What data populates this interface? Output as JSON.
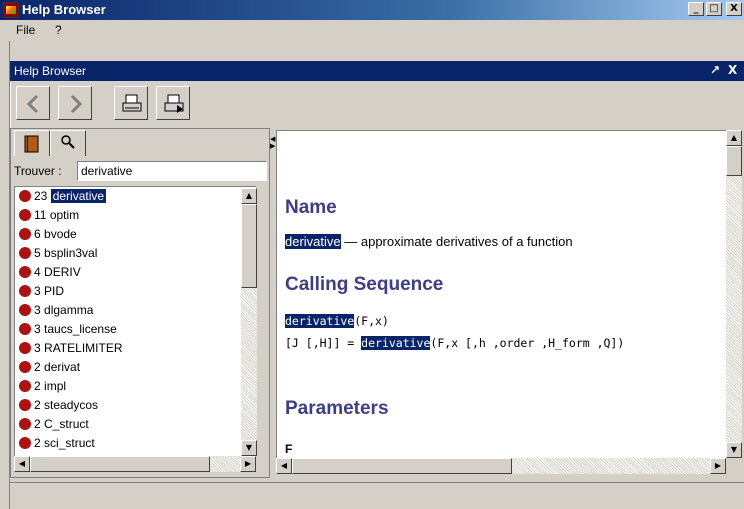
{
  "window": {
    "title": "Help Browser",
    "controls": [
      "_",
      "□",
      "X"
    ]
  },
  "menu": {
    "items": [
      "File",
      "?"
    ]
  },
  "frame": {
    "title": "Help Browser",
    "controls": [
      "↗",
      "X"
    ]
  },
  "toolbar": {
    "buttons": [
      "back-icon",
      "forward-icon",
      "print-icon",
      "print-setup-icon"
    ]
  },
  "search": {
    "label": "Trouver :",
    "value": "derivative"
  },
  "results": [
    {
      "count": "23",
      "term": "derivative",
      "selected": true
    },
    {
      "count": "11",
      "term": "optim"
    },
    {
      "count": "6",
      "term": "bvode"
    },
    {
      "count": "5",
      "term": "bsplin3val"
    },
    {
      "count": "4",
      "term": "DERIV"
    },
    {
      "count": "3",
      "term": "PID"
    },
    {
      "count": "3",
      "term": "dlgamma"
    },
    {
      "count": "3",
      "term": "taucs_license"
    },
    {
      "count": "3",
      "term": "RATELIMITER"
    },
    {
      "count": "2",
      "term": "derivat"
    },
    {
      "count": "2",
      "term": "impl"
    },
    {
      "count": "2",
      "term": "steadycos"
    },
    {
      "count": "2",
      "term": "C_struct"
    },
    {
      "count": "2",
      "term": "sci_struct"
    }
  ],
  "doc": {
    "name_heading": "Name",
    "name_term": "derivative",
    "name_desc": " — approximate derivatives of a function",
    "calling_heading": "Calling Sequence",
    "call1_fn": "derivative",
    "call1_args": "(F,x)",
    "call2_prefix": "[J [,H]] = ",
    "call2_fn": "derivative",
    "call2_args": "(F,x [,h ,order ,H_form ,Q])",
    "params_heading": "Parameters",
    "param_first": "F"
  },
  "colors": {
    "titlebar": "#0a246a",
    "heading": "#3d3d8b",
    "dot": "#b01010"
  }
}
